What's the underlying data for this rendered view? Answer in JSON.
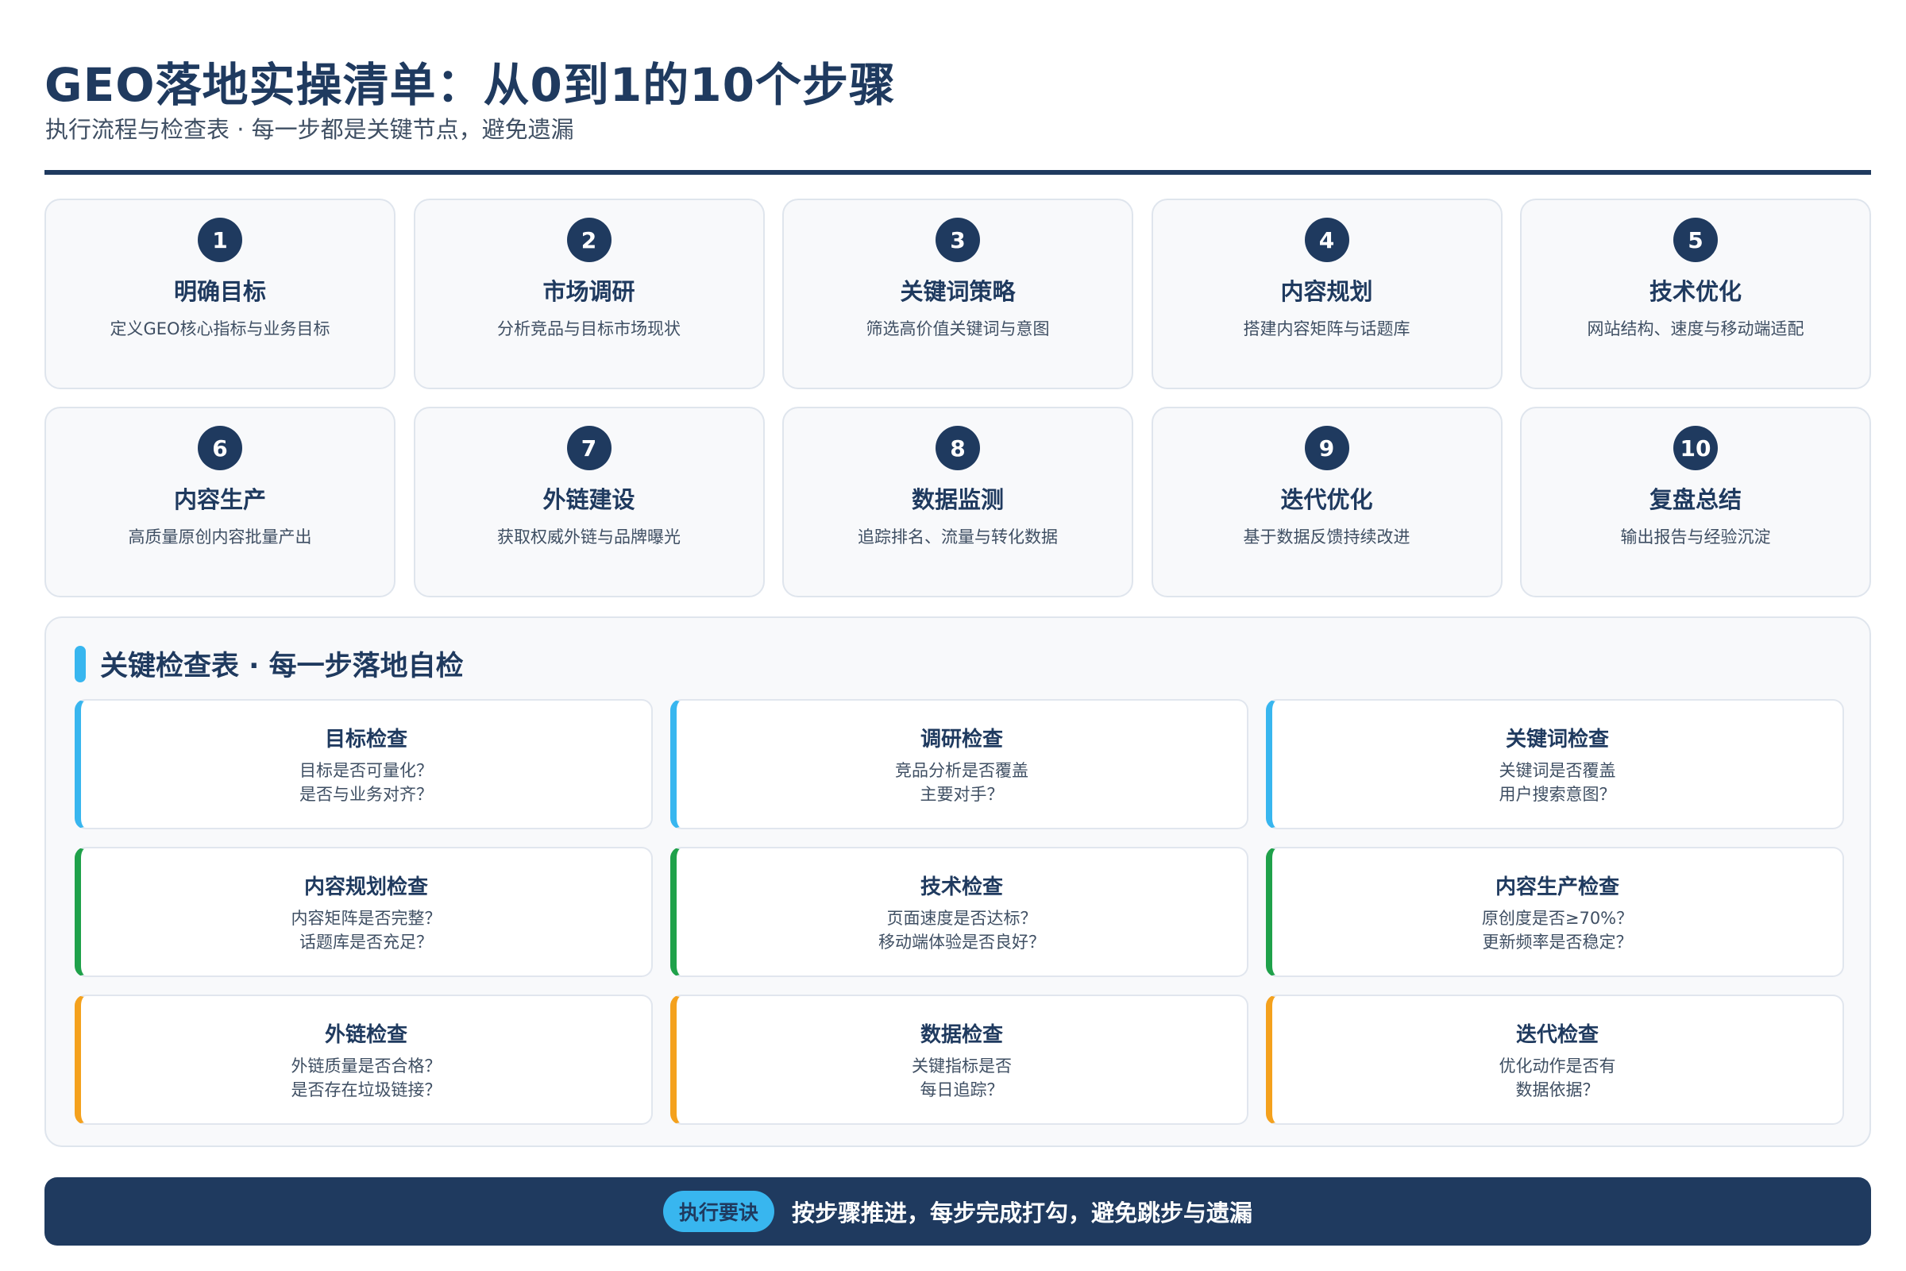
{
  "header": {
    "title": "GEO落地实操清单：从0到1的10个步骤",
    "subtitle": "执行流程与检查表 · 每一步都是关键节点，避免遗漏"
  },
  "steps": [
    {
      "num": "1",
      "title": "明确目标",
      "desc": "定义GEO核心指标与业务目标"
    },
    {
      "num": "2",
      "title": "市场调研",
      "desc": "分析竞品与目标市场现状"
    },
    {
      "num": "3",
      "title": "关键词策略",
      "desc": "筛选高价值关键词与意图"
    },
    {
      "num": "4",
      "title": "内容规划",
      "desc": "搭建内容矩阵与话题库"
    },
    {
      "num": "5",
      "title": "技术优化",
      "desc": "网站结构、速度与移动端适配"
    },
    {
      "num": "6",
      "title": "内容生产",
      "desc": "高质量原创内容批量产出"
    },
    {
      "num": "7",
      "title": "外链建设",
      "desc": "获取权威外链与品牌曝光"
    },
    {
      "num": "8",
      "title": "数据监测",
      "desc": "追踪排名、流量与转化数据"
    },
    {
      "num": "9",
      "title": "迭代优化",
      "desc": "基于数据反馈持续改进"
    },
    {
      "num": "10",
      "title": "复盘总结",
      "desc": "输出报告与经验沉淀"
    }
  ],
  "checklist": {
    "title": "关键检查表 · 每一步落地自检",
    "accent_colors": {
      "blue": "#38b6ef",
      "green": "#1fa14a",
      "orange": "#f4a11d"
    },
    "items": [
      {
        "title": "目标检查",
        "line1": "目标是否可量化？",
        "line2": "是否与业务对齐？"
      },
      {
        "title": "调研检查",
        "line1": "竞品分析是否覆盖",
        "line2": "主要对手？"
      },
      {
        "title": "关键词检查",
        "line1": "关键词是否覆盖",
        "line2": "用户搜索意图？"
      },
      {
        "title": "内容规划检查",
        "line1": "内容矩阵是否完整？",
        "line2": "话题库是否充足？"
      },
      {
        "title": "技术检查",
        "line1": "页面速度是否达标？",
        "line2": "移动端体验是否良好？"
      },
      {
        "title": "内容生产检查",
        "line1": "原创度是否≥70%？",
        "line2": "更新频率是否稳定？"
      },
      {
        "title": "外链检查",
        "line1": "外链质量是否合格？",
        "line2": "是否存在垃圾链接？"
      },
      {
        "title": "数据检查",
        "line1": "关键指标是否",
        "line2": "每日追踪？"
      },
      {
        "title": "迭代检查",
        "line1": "优化动作是否有",
        "line2": "数据依据？"
      }
    ]
  },
  "banner": {
    "badge": "执行要诀",
    "text": "按步骤推进，每步完成打勾，避免跳步与遗漏"
  },
  "colors": {
    "primary": "#1f3a5f",
    "accent": "#38b6ef"
  }
}
